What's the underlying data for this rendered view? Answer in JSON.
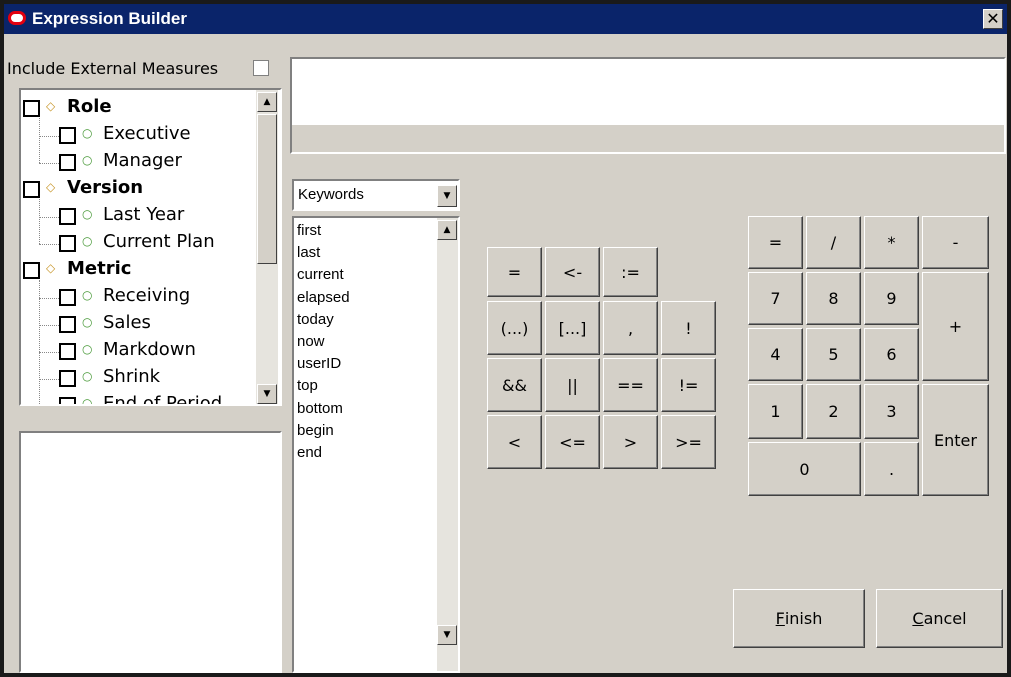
{
  "window": {
    "title": "Expression Builder",
    "close_glyph": "✕"
  },
  "external": {
    "label": "Include External Measures",
    "checked": false
  },
  "tree": {
    "items": [
      {
        "label": "Role",
        "level": 0,
        "kind": "dimension"
      },
      {
        "label": "Executive",
        "level": 1,
        "kind": "member"
      },
      {
        "label": "Manager",
        "level": 1,
        "kind": "member"
      },
      {
        "label": "Version",
        "level": 0,
        "kind": "dimension"
      },
      {
        "label": "Last Year",
        "level": 1,
        "kind": "member"
      },
      {
        "label": "Current Plan",
        "level": 1,
        "kind": "member"
      },
      {
        "label": "Metric",
        "level": 0,
        "kind": "dimension"
      },
      {
        "label": "Receiving",
        "level": 1,
        "kind": "member"
      },
      {
        "label": "Sales",
        "level": 1,
        "kind": "member"
      },
      {
        "label": "Markdown",
        "level": 1,
        "kind": "member"
      },
      {
        "label": "Shrink",
        "level": 1,
        "kind": "member"
      },
      {
        "label": "End of Period",
        "level": 1,
        "kind": "member"
      }
    ]
  },
  "keywords": {
    "selected": "Keywords",
    "items": [
      "first",
      "last",
      "current",
      "elapsed",
      "today",
      "now",
      "userID",
      "top",
      "bottom",
      "begin",
      "end"
    ]
  },
  "operators": {
    "row1": [
      "=",
      "<-",
      ":="
    ],
    "row2": [
      "(...)",
      "[...]",
      ",",
      "!"
    ],
    "row3": [
      "&&",
      "||",
      "==",
      "!="
    ],
    "row4": [
      "<",
      "<=",
      ">",
      ">="
    ]
  },
  "keypad": {
    "eq": "=",
    "div": "/",
    "mul": "*",
    "minus": "-",
    "d7": "7",
    "d8": "8",
    "d9": "9",
    "plus": "+",
    "d4": "4",
    "d5": "5",
    "d6": "6",
    "d1": "1",
    "d2": "2",
    "d3": "3",
    "enter": "Enter",
    "d0": "0",
    "dot": "."
  },
  "footer": {
    "finish_mnemonic": "F",
    "finish_rest": "inish",
    "cancel_mnemonic": "C",
    "cancel_rest": "ancel"
  },
  "icons": {
    "dimension": "◇",
    "member": "○",
    "dimension_color": "#c8962a",
    "member_color": "#4a9a3a"
  }
}
